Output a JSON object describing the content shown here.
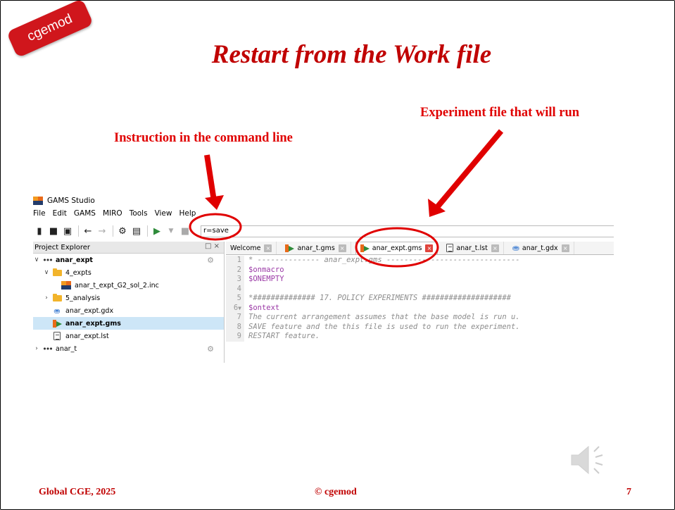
{
  "badge": {
    "text": "cgemod",
    "color": "#d0161c"
  },
  "slide": {
    "title": "Restart from the Work file",
    "title_color": "#c00000"
  },
  "annotations": {
    "command_line": "Instruction in the command line",
    "experiment": "Experiment file that will run",
    "color": "#e00000"
  },
  "gams": {
    "window_title": "GAMS Studio",
    "menu": [
      "File",
      "Edit",
      "GAMS",
      "MIRO",
      "Tools",
      "View",
      "Help"
    ],
    "command_line_value": "r=save",
    "project_explorer": {
      "header": "Project Explorer",
      "items": [
        {
          "label": "anar_expt",
          "icon": "project-icon"
        },
        {
          "label": "4_expts",
          "icon": "folder-icon"
        },
        {
          "label": "anar_t_expt_G2_sol_2.inc",
          "icon": "gams-file-icon"
        },
        {
          "label": "5_analysis",
          "icon": "folder-icon"
        },
        {
          "label": "anar_expt.gdx",
          "icon": "database-icon"
        },
        {
          "label": "anar_expt.gms",
          "icon": "gms-run-icon"
        },
        {
          "label": "anar_expt.lst",
          "icon": "listing-file-icon"
        },
        {
          "label": "anar_t",
          "icon": "project-icon"
        }
      ]
    },
    "tabs": [
      "Welcome",
      "anar_t.gms",
      "anar_expt.gms",
      "anar_t.lst",
      "anar_t.gdx"
    ],
    "active_tab": "anar_expt.gms",
    "code": [
      {
        "n": "1",
        "text": "* -------------- anar_expt.gms ------------------------------"
      },
      {
        "n": "2",
        "text": "$onmacro"
      },
      {
        "n": "3",
        "text": "$ONEMPTY"
      },
      {
        "n": "4",
        "text": ""
      },
      {
        "n": "5",
        "text": "*############## 17. POLICY EXPERIMENTS ####################"
      },
      {
        "n": "6",
        "text": "$ontext"
      },
      {
        "n": "7",
        "text": "The current arrangement assumes that the base model is run u."
      },
      {
        "n": "8",
        "text": "SAVE feature and the this file is used to run the experiment."
      },
      {
        "n": "9",
        "text": "RESTART feature."
      }
    ]
  },
  "footer": {
    "left": "Global CGE, 2025",
    "center": "© cgemod",
    "page": "7"
  }
}
